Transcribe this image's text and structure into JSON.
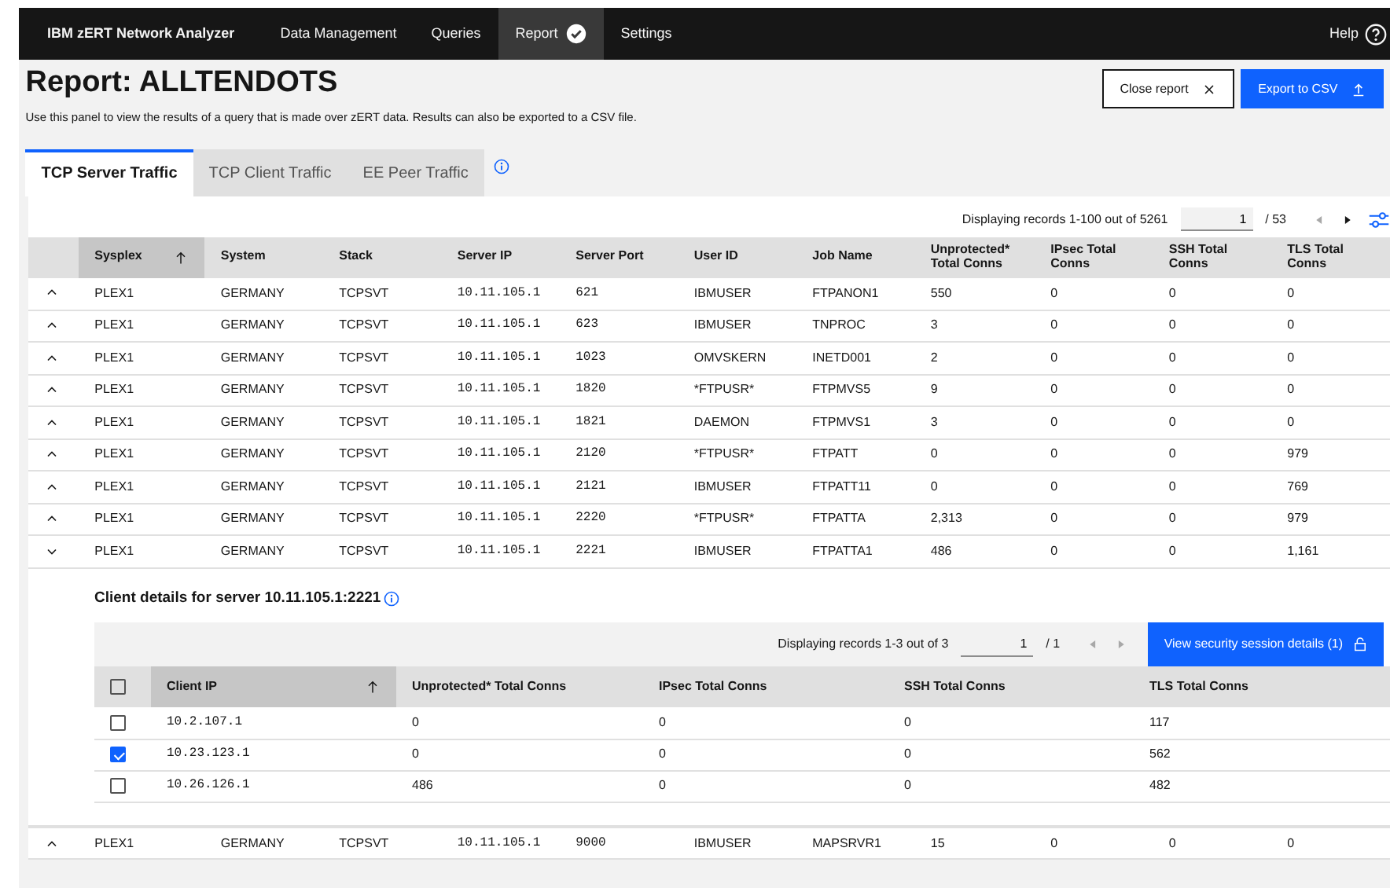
{
  "app": {
    "title": "IBM zERT Network Analyzer",
    "nav": [
      {
        "label": "Data Management",
        "selected": false,
        "done": false
      },
      {
        "label": "Queries",
        "selected": false,
        "done": false
      },
      {
        "label": "Report",
        "selected": true,
        "done": true
      },
      {
        "label": "Settings",
        "selected": false,
        "done": false
      }
    ],
    "help": "Help"
  },
  "page": {
    "title": "Report: ALLTENDOTS",
    "description": "Use this panel to view the results of a query that is made over zERT data. Results can also be exported to a CSV file.",
    "buttons": [
      {
        "label": "Close report",
        "kind": "secondary"
      },
      {
        "label": "Export to CSV",
        "kind": "primary"
      }
    ]
  },
  "tabs": [
    {
      "label": "TCP Server Traffic",
      "selected": true
    },
    {
      "label": "TCP Client Traffic",
      "selected": false
    },
    {
      "label": "EE Peer Traffic",
      "selected": false
    }
  ],
  "pagination": {
    "summary": "Displaying records 1-100 out of 5261",
    "page": "1",
    "total": "/ 53"
  },
  "table": {
    "columns": [
      {
        "label": "Sysplex",
        "sorted": true
      },
      {
        "label": "System",
        "sorted": false
      },
      {
        "label": "Stack",
        "sorted": false
      },
      {
        "label": "Server IP",
        "sorted": false
      },
      {
        "label": "Server Port",
        "sorted": false
      },
      {
        "label": "User ID",
        "sorted": false
      },
      {
        "label": "Job Name",
        "sorted": false
      },
      {
        "label": "Unprotected* Total Conns",
        "sorted": false
      },
      {
        "label": "IPsec Total Conns",
        "sorted": false
      },
      {
        "label": "SSH Total Conns",
        "sorted": false
      },
      {
        "label": "TLS Total Conns",
        "sorted": false
      }
    ],
    "rows": [
      {
        "expanded": false,
        "cells": [
          "PLEX1",
          "GERMANY",
          "TCPSVT",
          "10.11.105.1",
          "621",
          "IBMUSER",
          "FTPANON1",
          "550",
          "0",
          "0",
          "0"
        ]
      },
      {
        "expanded": false,
        "cells": [
          "PLEX1",
          "GERMANY",
          "TCPSVT",
          "10.11.105.1",
          "623",
          "IBMUSER",
          "TNPROC",
          "3",
          "0",
          "0",
          "0"
        ]
      },
      {
        "expanded": false,
        "cells": [
          "PLEX1",
          "GERMANY",
          "TCPSVT",
          "10.11.105.1",
          "1023",
          "OMVSKERN",
          "INETD001",
          "2",
          "0",
          "0",
          "0"
        ]
      },
      {
        "expanded": false,
        "cells": [
          "PLEX1",
          "GERMANY",
          "TCPSVT",
          "10.11.105.1",
          "1820",
          "*FTPUSR*",
          "FTPMVS5",
          "9",
          "0",
          "0",
          "0"
        ]
      },
      {
        "expanded": false,
        "cells": [
          "PLEX1",
          "GERMANY",
          "TCPSVT",
          "10.11.105.1",
          "1821",
          "DAEMON",
          "FTPMVS1",
          "3",
          "0",
          "0",
          "0"
        ]
      },
      {
        "expanded": false,
        "cells": [
          "PLEX1",
          "GERMANY",
          "TCPSVT",
          "10.11.105.1",
          "2120",
          "*FTPUSR*",
          "FTPATT",
          "0",
          "0",
          "0",
          "979"
        ]
      },
      {
        "expanded": false,
        "cells": [
          "PLEX1",
          "GERMANY",
          "TCPSVT",
          "10.11.105.1",
          "2121",
          "IBMUSER",
          "FTPATT11",
          "0",
          "0",
          "0",
          "769"
        ]
      },
      {
        "expanded": false,
        "cells": [
          "PLEX1",
          "GERMANY",
          "TCPSVT",
          "10.11.105.1",
          "2220",
          "*FTPUSR*",
          "FTPATTA",
          "2,313",
          "0",
          "0",
          "979"
        ]
      },
      {
        "expanded": true,
        "cells": [
          "PLEX1",
          "GERMANY",
          "TCPSVT",
          "10.11.105.1",
          "2221",
          "IBMUSER",
          "FTPATTA1",
          "486",
          "0",
          "0",
          "1,161"
        ]
      },
      {
        "expanded": false,
        "cells": [
          "PLEX1",
          "GERMANY",
          "TCPSVT",
          "10.11.105.1",
          "9000",
          "IBMUSER",
          "MAPSRVR1",
          "15",
          "0",
          "0",
          "0"
        ]
      }
    ]
  },
  "client_details": {
    "title": "Client details for server 10.11.105.1:2221",
    "pagination": {
      "summary": "Displaying records 1-3 out of 3",
      "page": "1",
      "total": "/ 1"
    },
    "button": "View security session details (1)",
    "all_checked": false,
    "columns": [
      {
        "label": "Client IP",
        "sorted": true
      },
      {
        "label": "Unprotected* Total Conns",
        "sorted": false
      },
      {
        "label": "IPsec Total Conns",
        "sorted": false
      },
      {
        "label": "SSH Total Conns",
        "sorted": false
      },
      {
        "label": "TLS Total Conns",
        "sorted": false
      }
    ],
    "rows": [
      {
        "checked": false,
        "cells": [
          "10.2.107.1",
          "0",
          "0",
          "0",
          "117"
        ]
      },
      {
        "checked": true,
        "cells": [
          "10.23.123.1",
          "0",
          "0",
          "0",
          "562"
        ]
      },
      {
        "checked": false,
        "cells": [
          "10.26.126.1",
          "486",
          "0",
          "0",
          "482"
        ]
      }
    ]
  }
}
